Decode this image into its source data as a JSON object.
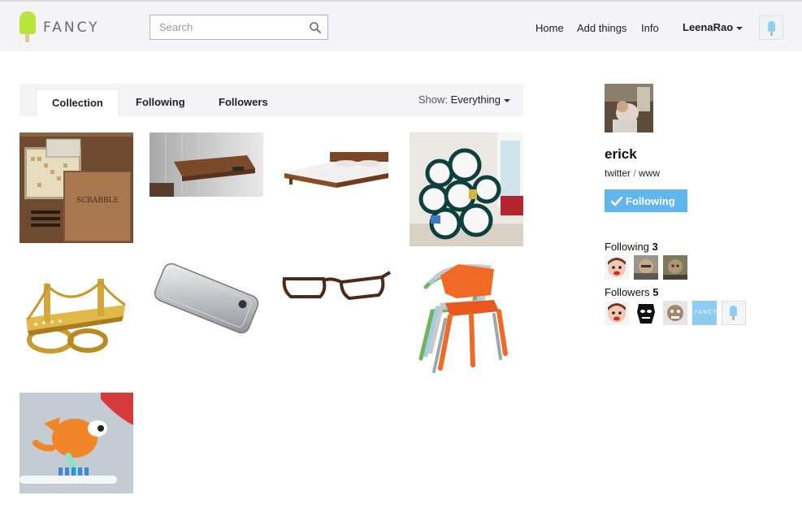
{
  "header": {
    "logo_text": "FANCY",
    "search_placeholder": "Search",
    "nav": {
      "home": "Home",
      "add": "Add things",
      "info": "Info"
    },
    "username": "LeenaRao"
  },
  "tabs": {
    "collection": "Collection",
    "following": "Following",
    "followers": "Followers",
    "show_label": "Show:",
    "show_value": "Everything"
  },
  "items": [
    "scrabble-box",
    "wooden-wall-shelf",
    "wooden-bed",
    "circle-shelves",
    "bridge-ring",
    "silver-iphone-case",
    "glasses",
    "stacked-chairs",
    "toothbrush-figure"
  ],
  "profile": {
    "name": "erick",
    "link_twitter": "twitter",
    "link_sep": "/",
    "link_www": "www",
    "follow_button": "Following",
    "following_label": "Following",
    "following_count": "3",
    "followers_label": "Followers",
    "followers_count": "5",
    "follower_badge_text": "FANCY"
  },
  "colors": {
    "accent": "#62b6ee",
    "logo_green": "#b8e63a",
    "header_bg": "#f4f4f7"
  }
}
